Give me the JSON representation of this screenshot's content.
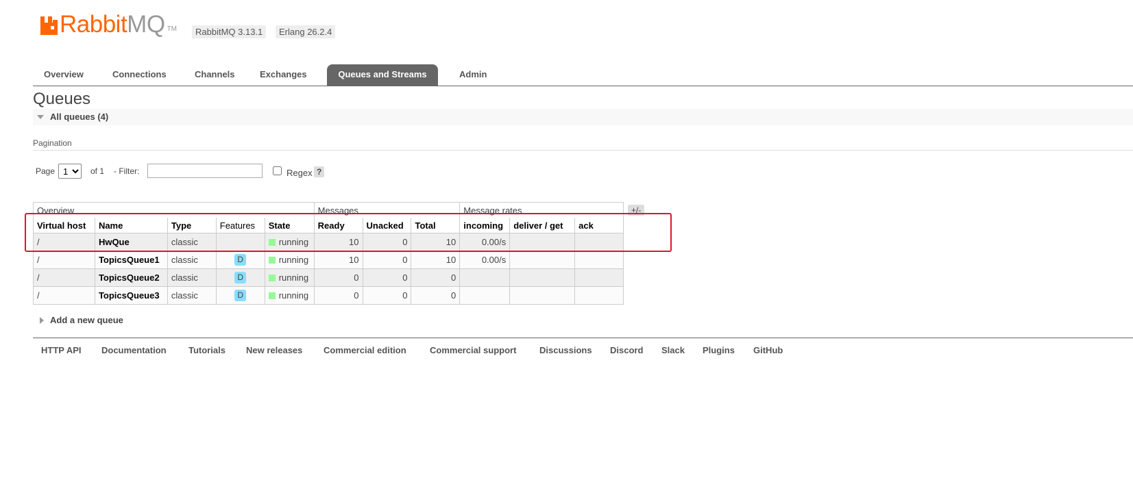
{
  "header": {
    "logo_text_rabbit": "Rabbit",
    "logo_text_mq": "MQ",
    "logo_tm": "TM",
    "rabbitmq_version": "RabbitMQ 3.13.1",
    "erlang_version": "Erlang 26.2.4",
    "brand_color": "#ff6600"
  },
  "nav": {
    "tabs": [
      "Overview",
      "Connections",
      "Channels",
      "Exchanges",
      "Queues and Streams",
      "Admin"
    ],
    "active": "Queues and Streams"
  },
  "page": {
    "title": "Queues",
    "section_label": "All queues (4)"
  },
  "pagination": {
    "title": "Pagination",
    "page_label": "Page",
    "page_value": "1",
    "page_options": [
      "1"
    ],
    "of_label": "of 1",
    "filter_label": "- Filter:",
    "filter_value": "",
    "regex_label": "Regex",
    "help_label": "?"
  },
  "table": {
    "groups": [
      "Overview",
      "Messages",
      "Message rates"
    ],
    "plus_minus_label": "+/-",
    "columns": [
      "Virtual host",
      "Name",
      "Type",
      "Features",
      "State",
      "Ready",
      "Unacked",
      "Total",
      "incoming",
      "deliver / get",
      "ack"
    ],
    "rows": [
      {
        "vhost": "/",
        "name": "HwQue",
        "type": "classic",
        "features": "",
        "state": "running",
        "ready": "10",
        "unacked": "0",
        "total": "10",
        "incoming": "0.00/s",
        "deliver_get": "",
        "ack": ""
      },
      {
        "vhost": "/",
        "name": "TopicsQueue1",
        "type": "classic",
        "features": "D",
        "state": "running",
        "ready": "10",
        "unacked": "0",
        "total": "10",
        "incoming": "0.00/s",
        "deliver_get": "",
        "ack": ""
      },
      {
        "vhost": "/",
        "name": "TopicsQueue2",
        "type": "classic",
        "features": "D",
        "state": "running",
        "ready": "0",
        "unacked": "0",
        "total": "0",
        "incoming": "",
        "deliver_get": "",
        "ack": ""
      },
      {
        "vhost": "/",
        "name": "TopicsQueue3",
        "type": "classic",
        "features": "D",
        "state": "running",
        "ready": "0",
        "unacked": "0",
        "total": "0",
        "incoming": "",
        "deliver_get": "",
        "ack": ""
      }
    ],
    "state_color": "#98f898",
    "feature_badge_color": "#88ddff",
    "highlight_color": "#e3161c"
  },
  "add_queue": {
    "label": "Add a new queue"
  },
  "footer": {
    "links": [
      "HTTP API",
      "Documentation",
      "Tutorials",
      "New releases",
      "Commercial edition",
      "Commercial support",
      "Discussions",
      "Discord",
      "Slack",
      "Plugins",
      "GitHub"
    ]
  }
}
